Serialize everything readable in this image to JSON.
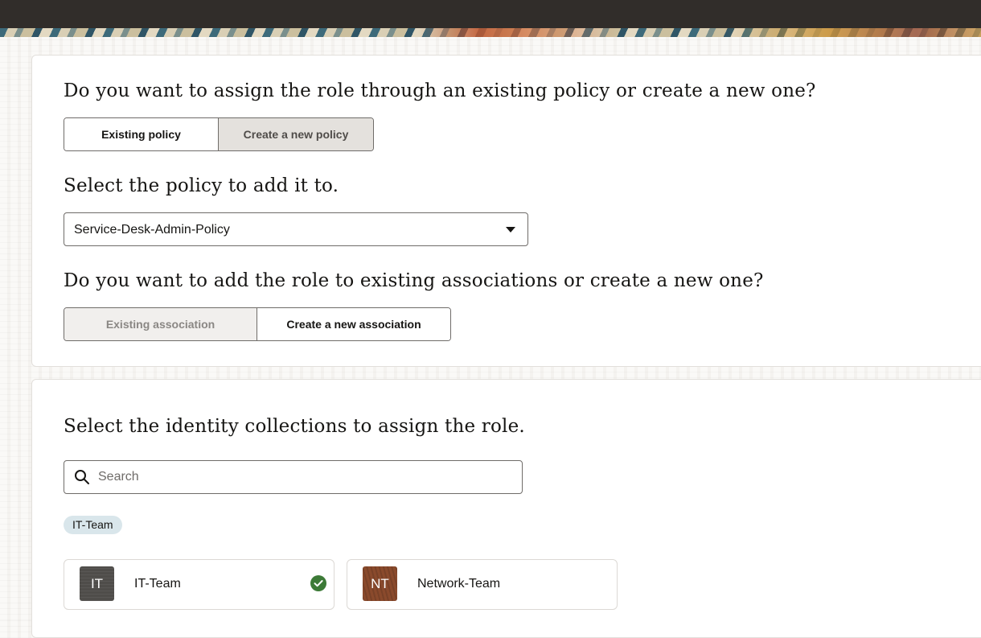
{
  "colors": {
    "topbar": "#312d2a",
    "chip_bg": "#d9e6eb",
    "check_green": "#3c7a37"
  },
  "policy_section": {
    "question": "Do you want to assign the role through an existing policy or create a new one?",
    "options": [
      "Existing policy",
      "Create a new policy"
    ],
    "selected": "Existing policy"
  },
  "policy_select": {
    "label": "Select the policy to add it to.",
    "value": "Service-Desk-Admin-Policy",
    "icon": "chevron-down-icon"
  },
  "association_section": {
    "question": "Do you want to add the role to existing associations or create a new one?",
    "options": [
      "Existing association",
      "Create a new association"
    ],
    "selected": "Create a new association",
    "disabled": "Existing association"
  },
  "identity_section": {
    "label": "Select the identity collections to assign the role.",
    "search": {
      "placeholder": "Search",
      "value": "",
      "icon": "search-icon"
    },
    "selected_chips": [
      "IT-Team"
    ],
    "collections": [
      {
        "initials": "IT",
        "name": "IT-Team",
        "selected": true,
        "icon": "check-circle-icon"
      },
      {
        "initials": "NT",
        "name": "Network-Team",
        "selected": false
      }
    ]
  }
}
